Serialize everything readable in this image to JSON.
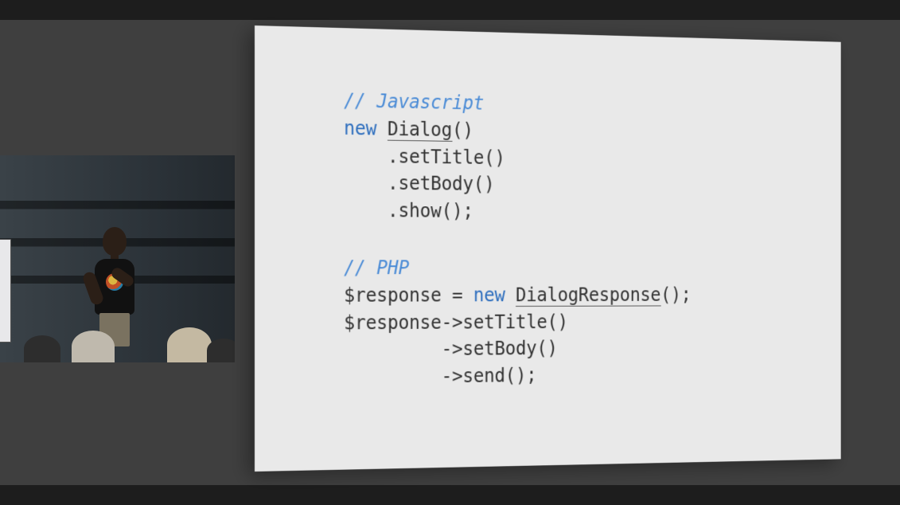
{
  "slide": {
    "js": {
      "comment": "// Javascript",
      "kw_new": "new",
      "class_name": "Dialog",
      "ctor_parens": "()",
      "line2": ".setTitle()",
      "line3": ".setBody()",
      "line4": ".show();"
    },
    "php": {
      "comment": "// PHP",
      "var": "$response",
      "equals": " = ",
      "kw_new": "new",
      "class_name": "DialogResponse",
      "ctor_tail": "();",
      "line2a": "$response->setTitle()",
      "line3": "->setBody()",
      "line4": "->send();"
    }
  },
  "video": {
    "description": "speaker-on-stage"
  }
}
